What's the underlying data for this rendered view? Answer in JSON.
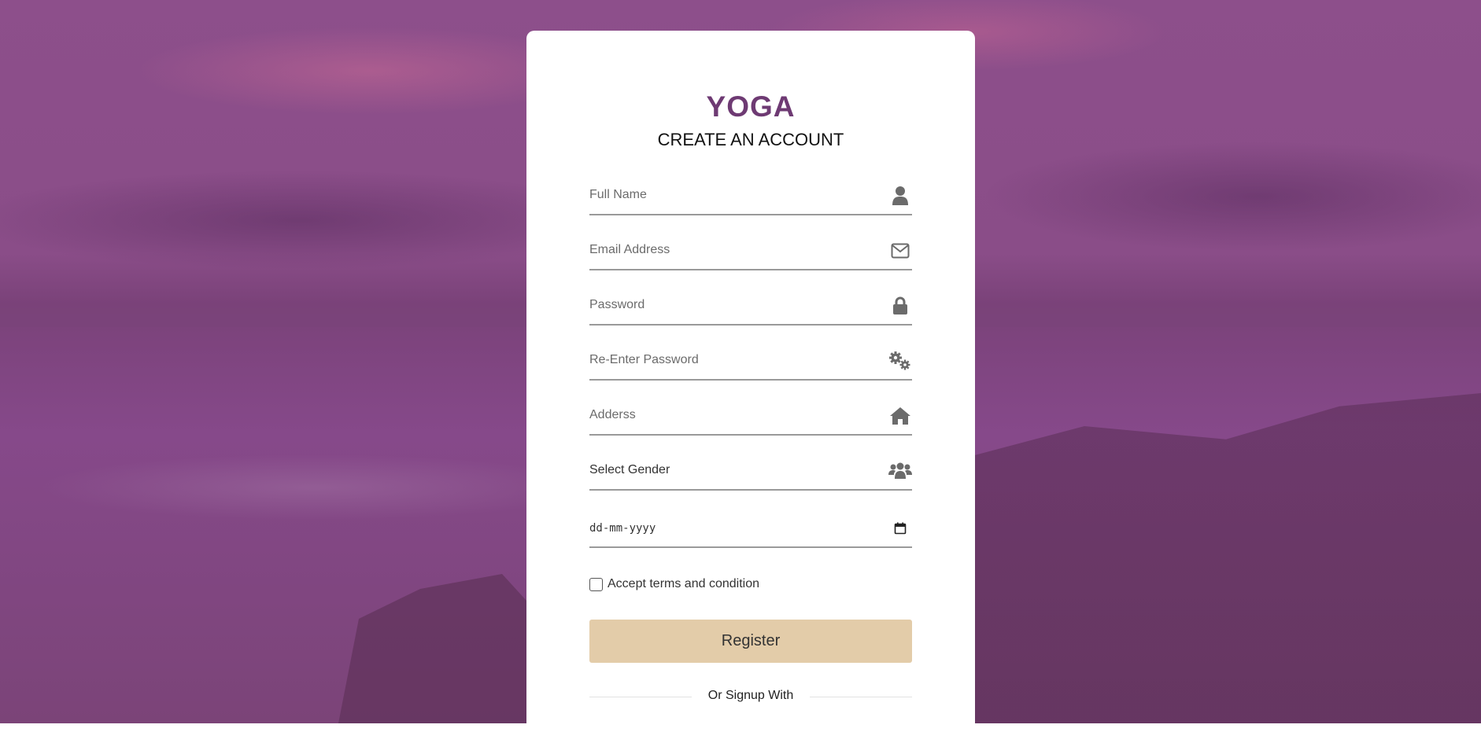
{
  "brand": "YOGA",
  "subtitle": "CREATE AN ACCOUNT",
  "form": {
    "full_name": {
      "placeholder": "Full Name",
      "value": "",
      "icon": "user-icon"
    },
    "email": {
      "placeholder": "Email Address",
      "value": "",
      "icon": "envelope-icon"
    },
    "password": {
      "placeholder": "Password",
      "value": "",
      "icon": "lock-icon"
    },
    "reenter_password": {
      "placeholder": "Re-Enter Password",
      "value": "",
      "icon": "gears-icon"
    },
    "address": {
      "placeholder": "Adderss",
      "value": "",
      "icon": "home-icon"
    },
    "gender": {
      "selected": "Select Gender",
      "icon": "users-icon"
    },
    "dob": {
      "placeholder": "dd-mm-yyyy",
      "icon": "calendar-icon"
    },
    "terms": {
      "label": "Accept terms and condition",
      "checked": false
    },
    "register_label": "Register",
    "alt_signup_text": "Or Signup With"
  },
  "colors": {
    "brand": "#6e3a73",
    "register_button": "#e3cca9",
    "background_tint": "#8a4d88",
    "icon": "#6b6b6b"
  }
}
